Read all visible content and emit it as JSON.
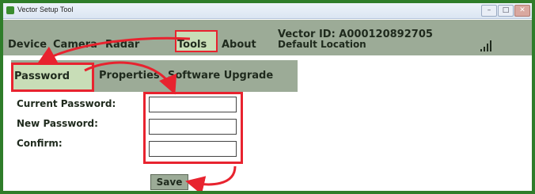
{
  "window": {
    "title": "Vector Setup Tool",
    "controls": [
      "–",
      "□",
      "✕"
    ]
  },
  "menu": {
    "items": [
      "Device",
      "Camera",
      "Radar",
      "Tools",
      "About"
    ],
    "selected": "Tools"
  },
  "status": {
    "vector_id": "Vector ID: A000120892705",
    "location": "Default Location",
    "signal_icon": "signal-strength-icon"
  },
  "submenu": {
    "items": [
      "Password",
      "Properties",
      "Software Upgrade"
    ],
    "selected": "Password"
  },
  "form": {
    "current_password_label": "Current Password:",
    "new_password_label": "New Password:",
    "confirm_label": "Confirm:",
    "current_password_value": "",
    "new_password_value": "",
    "confirm_value": "",
    "save_label": "Save"
  },
  "colors": {
    "background": "#2f7d2a",
    "bar": "#9cab97",
    "selected": "#c8ddb7",
    "highlight": "#e8232f"
  }
}
